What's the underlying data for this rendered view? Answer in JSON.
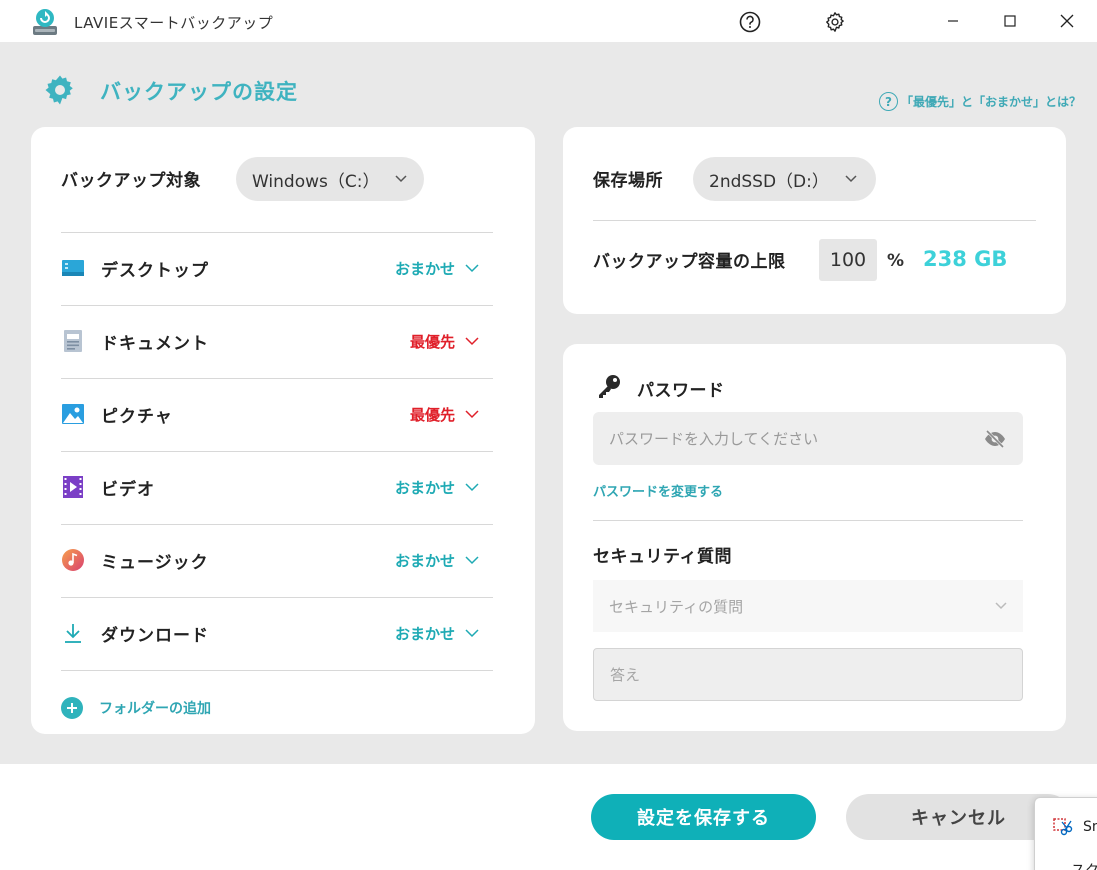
{
  "window": {
    "title": "LAVIEスマートバックアップ",
    "help_icon": "question-circle-icon",
    "settings_icon": "gear-icon"
  },
  "header": {
    "title": "バックアップの設定",
    "help_link": "「最優先」と「おまかせ」とは？"
  },
  "source": {
    "label": "バックアップ対象",
    "drive": "Windows（C:）",
    "folders": [
      {
        "name": "デスクトップ",
        "icon": "desktop-folder-icon",
        "mode": "おまかせ",
        "mode_type": "auto"
      },
      {
        "name": "ドキュメント",
        "icon": "document-folder-icon",
        "mode": "最優先",
        "mode_type": "priority"
      },
      {
        "name": "ピクチャ",
        "icon": "picture-folder-icon",
        "mode": "最優先",
        "mode_type": "priority"
      },
      {
        "name": "ビデオ",
        "icon": "video-folder-icon",
        "mode": "おまかせ",
        "mode_type": "auto"
      },
      {
        "name": "ミュージック",
        "icon": "music-folder-icon",
        "mode": "おまかせ",
        "mode_type": "auto"
      },
      {
        "name": "ダウンロード",
        "icon": "download-folder-icon",
        "mode": "おまかせ",
        "mode_type": "auto"
      }
    ],
    "add_folder": "フォルダーの追加"
  },
  "destination": {
    "label": "保存場所",
    "drive": "2ndSSD（D:）",
    "capacity_label": "バックアップ容量の上限",
    "capacity_value": "100",
    "capacity_unit": "%",
    "capacity_size": "238 GB"
  },
  "password": {
    "title": "パスワード",
    "placeholder": "パスワードを入力してください",
    "change_link": "パスワードを変更する",
    "security_title": "セキュリティ質問",
    "security_placeholder": "セキュリティの質問",
    "answer_placeholder": "答え"
  },
  "footer": {
    "save": "設定を保存する",
    "cancel": "キャンセル"
  },
  "snip_popup": {
    "row1": "Sn",
    "row2": "スクリ"
  },
  "colors": {
    "accent": "#1eaab4",
    "priority": "#e0202a",
    "capacity": "#3dd1d9",
    "save_button": "#0fb0b8"
  }
}
